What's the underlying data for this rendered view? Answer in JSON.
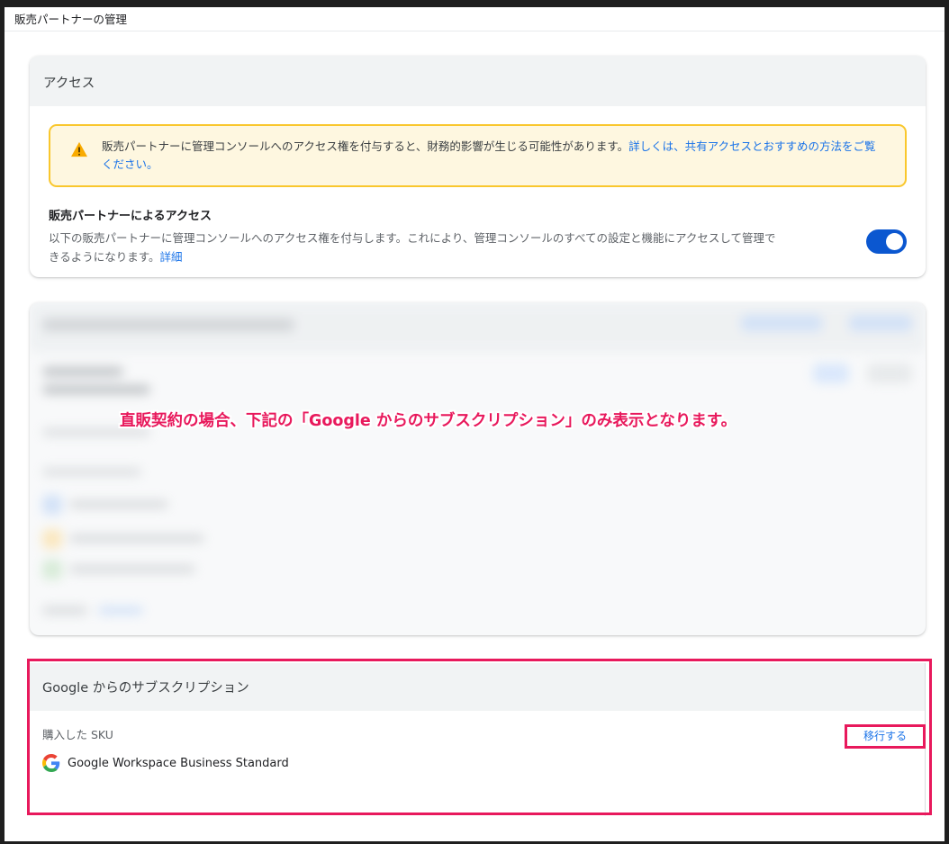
{
  "page": {
    "title": "販売パートナーの管理"
  },
  "access_card": {
    "header": "アクセス",
    "warning": {
      "icon": "warning-icon",
      "text": "販売パートナーに管理コンソールへのアクセス権を付与すると、財務的影響が生じる可能性があります。",
      "link": "詳しくは、共有アクセスとおすすめの方法をご覧ください。"
    },
    "partner_access": {
      "title": "販売パートナーによるアクセス",
      "description": "以下の販売パートナーに管理コンソールへのアクセス権を付与します。これにより、管理コンソールのすべての設定と機能にアクセスして管理できるようになります。",
      "link": "詳細",
      "toggle_on": true
    }
  },
  "annotation": "直販契約の場合、下記の「Google からのサブスクリプション」のみ表示となります。",
  "subscription_card": {
    "header": "Google からのサブスクリプション",
    "sku_label": "購入した SKU",
    "sku_name": "Google Workspace Business Standard",
    "sku_icon": "google-logo-icon",
    "migrate_label": "移行する"
  },
  "colors": {
    "accent": "#1a73e8",
    "toggle": "#0b57d0",
    "warning_bg": "#fef7e0",
    "warning_border": "#f9c72d",
    "highlight": "#e8195c"
  }
}
